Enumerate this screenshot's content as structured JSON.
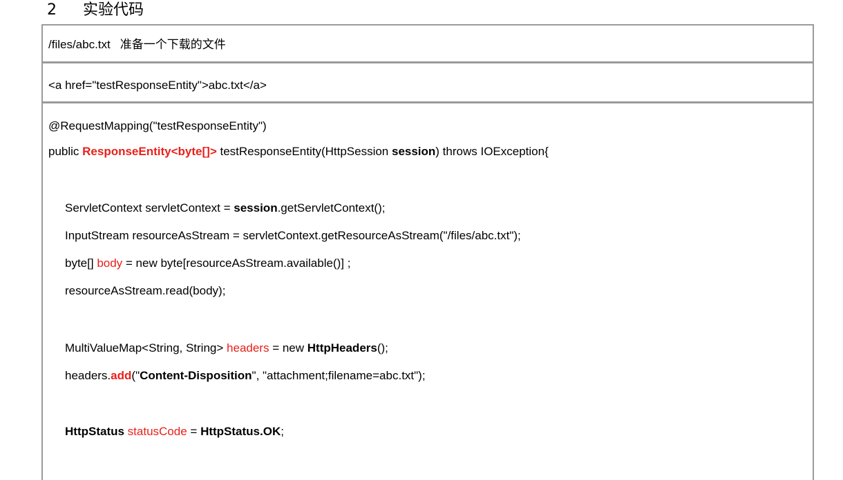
{
  "heading": {
    "number": "2",
    "title": "实验代码"
  },
  "rows": {
    "file_path": "/files/abc.txt",
    "file_note": "准备一个下载的文件",
    "link_html": "<a href=\"testResponseEntity\">abc.txt</a>"
  },
  "code": {
    "line1": "@RequestMapping(\"testResponseEntity\")",
    "line2": {
      "p1": "public ",
      "p2": "ResponseEntity<byte[]>",
      "p3": " testResponseEntity(HttpSession ",
      "p4": "session",
      "p5": ") throws IOException{"
    },
    "line3": {
      "p1": "ServletContext servletContext = ",
      "p2": "session",
      "p3": ".getServletContext();"
    },
    "line4": "InputStream resourceAsStream = servletContext.getResourceAsStream(\"/files/abc.txt\");",
    "line5": {
      "p1": "byte[] ",
      "p2": "body",
      "p3": " = new byte[resourceAsStream.available()] ;"
    },
    "line6": "resourceAsStream.read(body);",
    "line7": {
      "p1": "MultiValueMap<String, String> ",
      "p2": "headers",
      "p3": " = new ",
      "p4": "HttpHeaders",
      "p5": "();"
    },
    "line8": {
      "p1": "headers.",
      "p2": "add",
      "p3": "(\"",
      "p4": "Content-Disposition",
      "p5": "\", \"attachment;filename=abc.txt\");"
    },
    "line9": {
      "p1": "HttpStatus",
      "p2": " statusCode",
      "p3": " = ",
      "p4": "HttpStatus.OK",
      "p5": ";"
    }
  },
  "colors": {
    "highlight": "#e8201a",
    "border": "#9a9a9a"
  }
}
